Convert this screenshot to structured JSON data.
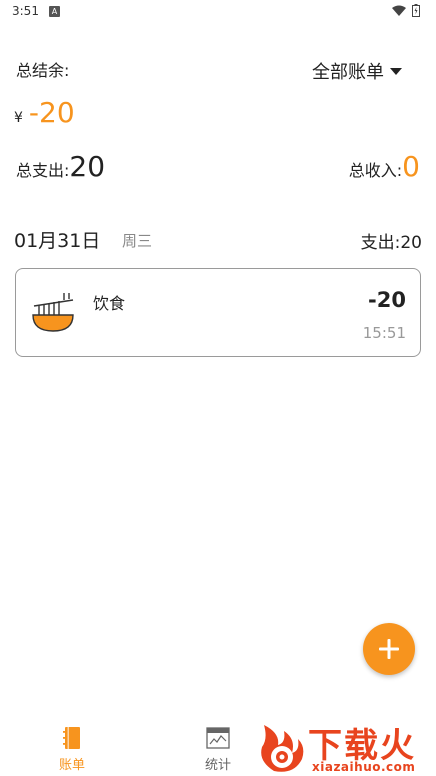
{
  "status_bar": {
    "time": "3:51",
    "notification_icon": "A"
  },
  "summary": {
    "balance_label": "总结余:",
    "currency_symbol": "¥",
    "balance_value": "-20",
    "account_selector": "全部账单",
    "expense_label": "总支出:",
    "expense_value": "20",
    "income_label": "总收入:",
    "income_value": "0"
  },
  "day_group": {
    "date": "01月31日",
    "weekday": "周三",
    "expense_label": "支出:",
    "expense_value": "20"
  },
  "transactions": [
    {
      "category": "饮食",
      "icon": "noodle-bowl-icon",
      "amount": "-20",
      "time": "15:51"
    }
  ],
  "bottom_nav": [
    {
      "label": "账单",
      "icon": "notebook-icon",
      "active": true
    },
    {
      "label": "统计",
      "icon": "chart-icon",
      "active": false
    }
  ],
  "watermark": {
    "title": "下载火",
    "subtitle": "xiazaihuo.com"
  },
  "colors": {
    "accent": "#f7941e",
    "watermark": "#e8441e",
    "text": "#222222",
    "muted": "#999999"
  }
}
